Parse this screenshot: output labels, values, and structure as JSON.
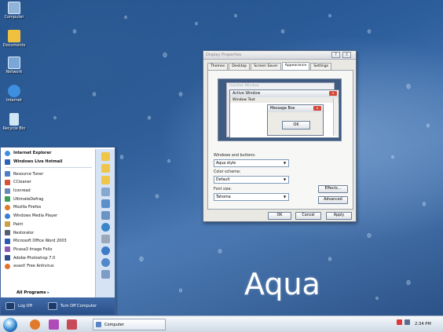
{
  "desktop": {
    "icons": [
      {
        "label": "Computer",
        "icon": "computer-icon",
        "color": "#8fb3d9"
      },
      {
        "label": "Documents",
        "icon": "documents-folder-icon",
        "color": "#f0c040"
      },
      {
        "label": "Network",
        "icon": "network-icon",
        "color": "#7aa6d8"
      },
      {
        "label": "Internet",
        "icon": "internet-explorer-icon",
        "color": "#3f8fe0"
      },
      {
        "label": "Recycle Bin",
        "icon": "recycle-bin-icon",
        "color": "#cfe6f5"
      }
    ],
    "brand_text": "Aqua"
  },
  "display_properties": {
    "title": "Display Properties",
    "help_btn": "?",
    "close_btn": "X",
    "tabs": [
      "Themes",
      "Desktop",
      "Screen Saver",
      "Appearance",
      "Settings"
    ],
    "active_tab": "Appearance",
    "preview": {
      "inactive_title": "Inactive Window",
      "active_title": "Active Window",
      "window_text": "Window Text",
      "message_box_title": "Message Box",
      "ok_label": "OK"
    },
    "windows_buttons_label": "Windows and buttons:",
    "windows_buttons_value": "Aqua style",
    "color_scheme_label": "Color scheme:",
    "color_scheme_value": "Default",
    "font_size_label": "Font size:",
    "font_size_value": "Tahoma",
    "effects_label": "Effects...",
    "advanced_label": "Advanced",
    "ok_label": "OK",
    "cancel_label": "Cancel",
    "apply_label": "Apply"
  },
  "start_menu": {
    "pinned": [
      {
        "label": "Internet Explorer",
        "icon": "internet-explorer-icon",
        "color": "#3f8fe0"
      },
      {
        "label": "Windows Live Hotmail",
        "icon": "hotmail-icon",
        "color": "#2a63b8"
      }
    ],
    "recent": [
      {
        "label": "Resource Tuner",
        "icon": "resource-tuner-icon",
        "color": "#4d7fc2"
      },
      {
        "label": "CCleaner",
        "icon": "ccleaner-icon",
        "color": "#d8523a"
      },
      {
        "label": "Iconread",
        "icon": "iconread-icon",
        "color": "#6a8ab8"
      },
      {
        "label": "UltimateDefrag",
        "icon": "defrag-icon",
        "color": "#3da05a"
      },
      {
        "label": "Mozilla Firefox",
        "icon": "firefox-icon",
        "color": "#e07a2a"
      },
      {
        "label": "Windows Media Player",
        "icon": "media-player-icon",
        "color": "#3b7fd0"
      },
      {
        "label": "Paint",
        "icon": "paint-icon",
        "color": "#caa04a"
      },
      {
        "label": "Restorator",
        "icon": "restorator-icon",
        "color": "#555f70"
      },
      {
        "label": "Microsoft Office Word 2003",
        "icon": "word-icon",
        "color": "#2b59b3"
      },
      {
        "label": "Picasa3 Image Folio",
        "icon": "picasa-icon",
        "color": "#8a5ab8"
      },
      {
        "label": "Adobe Photoshop 7.0",
        "icon": "photoshop-icon",
        "color": "#2e4d8c"
      },
      {
        "label": "avast! Free Antivirus",
        "icon": "avast-icon",
        "color": "#e3722a"
      }
    ],
    "all_programs": "All Programs",
    "right_icons": [
      {
        "icon": "folder-icon",
        "color": "#f0c64a"
      },
      {
        "icon": "folder-icon",
        "color": "#f0c64a"
      },
      {
        "icon": "folder-icon",
        "color": "#f0c64a"
      },
      {
        "icon": "computer-icon",
        "color": "#86a8cf"
      },
      {
        "icon": "network-icon",
        "color": "#5b8fc9"
      },
      {
        "icon": "control-panel-icon",
        "color": "#6b93c4"
      },
      {
        "icon": "globe-icon",
        "color": "#3a86c8"
      },
      {
        "icon": "printer-icon",
        "color": "#9aa8b8"
      },
      {
        "icon": "help-icon",
        "color": "#3f7cc8"
      },
      {
        "icon": "search-icon",
        "color": "#5088c8"
      },
      {
        "icon": "run-icon",
        "color": "#7d9cc6"
      }
    ],
    "log_off": "Log Off",
    "turn_off": "Turn Off Computer"
  },
  "taskbar": {
    "quick_launch": [
      {
        "icon": "firefox-icon",
        "color": "#e07a2a"
      },
      {
        "icon": "key-icon",
        "color": "#b04ab8"
      },
      {
        "icon": "media-icon",
        "color": "#c84a5a"
      }
    ],
    "task_button": "Computer",
    "clock": "2:34 PM",
    "colors": {
      "accent": "#3b6aa8"
    }
  }
}
